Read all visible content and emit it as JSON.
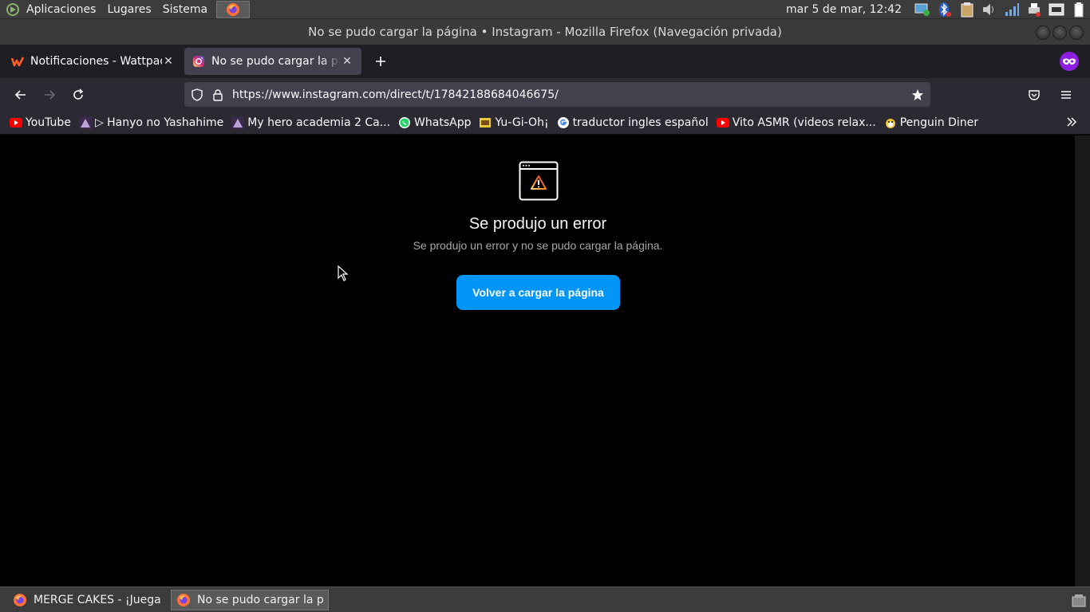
{
  "top_panel": {
    "menus": [
      "Aplicaciones",
      "Lugares",
      "Sistema"
    ],
    "clock": "mar  5 de mar, 12:42"
  },
  "window": {
    "title": "No se pudo cargar la página • Instagram - Mozilla Firefox (Navegación privada)"
  },
  "tabs": [
    {
      "label": "Notificaciones - Wattpad",
      "favicon": "wattpad-icon"
    },
    {
      "label": "No se pudo cargar la página • Instagram",
      "favicon": "instagram-icon"
    }
  ],
  "urlbar": {
    "url": "https://www.instagram.com/direct/t/17842188684046675/"
  },
  "bookmarks": [
    {
      "label": "YouTube",
      "icon": "youtube-icon"
    },
    {
      "label": "▷ Hanyo no Yashahime",
      "icon": "anime-icon"
    },
    {
      "label": "My hero academia 2 Ca...",
      "icon": "anime-icon"
    },
    {
      "label": "WhatsApp",
      "icon": "whatsapp-icon"
    },
    {
      "label": "Yu-Gi-Oh¡",
      "icon": "yugioh-icon"
    },
    {
      "label": "traductor ingles español",
      "icon": "google-icon"
    },
    {
      "label": "Vito ASMR (videos relax...",
      "icon": "youtube-icon"
    },
    {
      "label": "Penguin Diner",
      "icon": "penguin-icon"
    }
  ],
  "error_page": {
    "title": "Se produjo un error",
    "subtitle": "Se produjo un error y no se pudo cargar la página.",
    "reload_label": "Volver a cargar la página"
  },
  "taskbar": {
    "tasks": [
      {
        "label": "MERGE CAKES - ¡Juega ..."
      },
      {
        "label": "No se pudo cargar la pá..."
      }
    ]
  },
  "colors": {
    "accent": "#0095f6",
    "private": "#8f1fe0"
  }
}
